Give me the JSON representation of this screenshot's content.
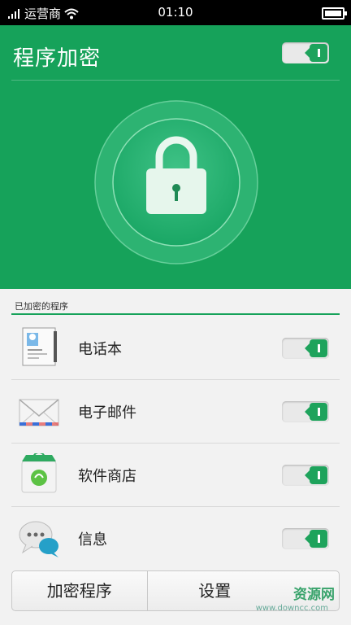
{
  "status_bar": {
    "carrier": "运营商",
    "time": "01:10"
  },
  "header": {
    "title": "程序加密",
    "master_toggle": "on"
  },
  "section": {
    "label": "已加密的程序"
  },
  "apps": [
    {
      "name": "电话本",
      "icon": "contacts-icon",
      "locked": "on"
    },
    {
      "name": "电子邮件",
      "icon": "email-icon",
      "locked": "on"
    },
    {
      "name": "软件商店",
      "icon": "store-icon",
      "locked": "on"
    },
    {
      "name": "信息",
      "icon": "messages-icon",
      "locked": "on"
    }
  ],
  "bottom": {
    "encrypt_label": "加密程序",
    "settings_label": "设置"
  },
  "watermark": {
    "text": "资源网",
    "url": "www.downcc.com"
  },
  "colors": {
    "brand_green": "#16a25a",
    "toggle_green": "#1ea35c"
  }
}
